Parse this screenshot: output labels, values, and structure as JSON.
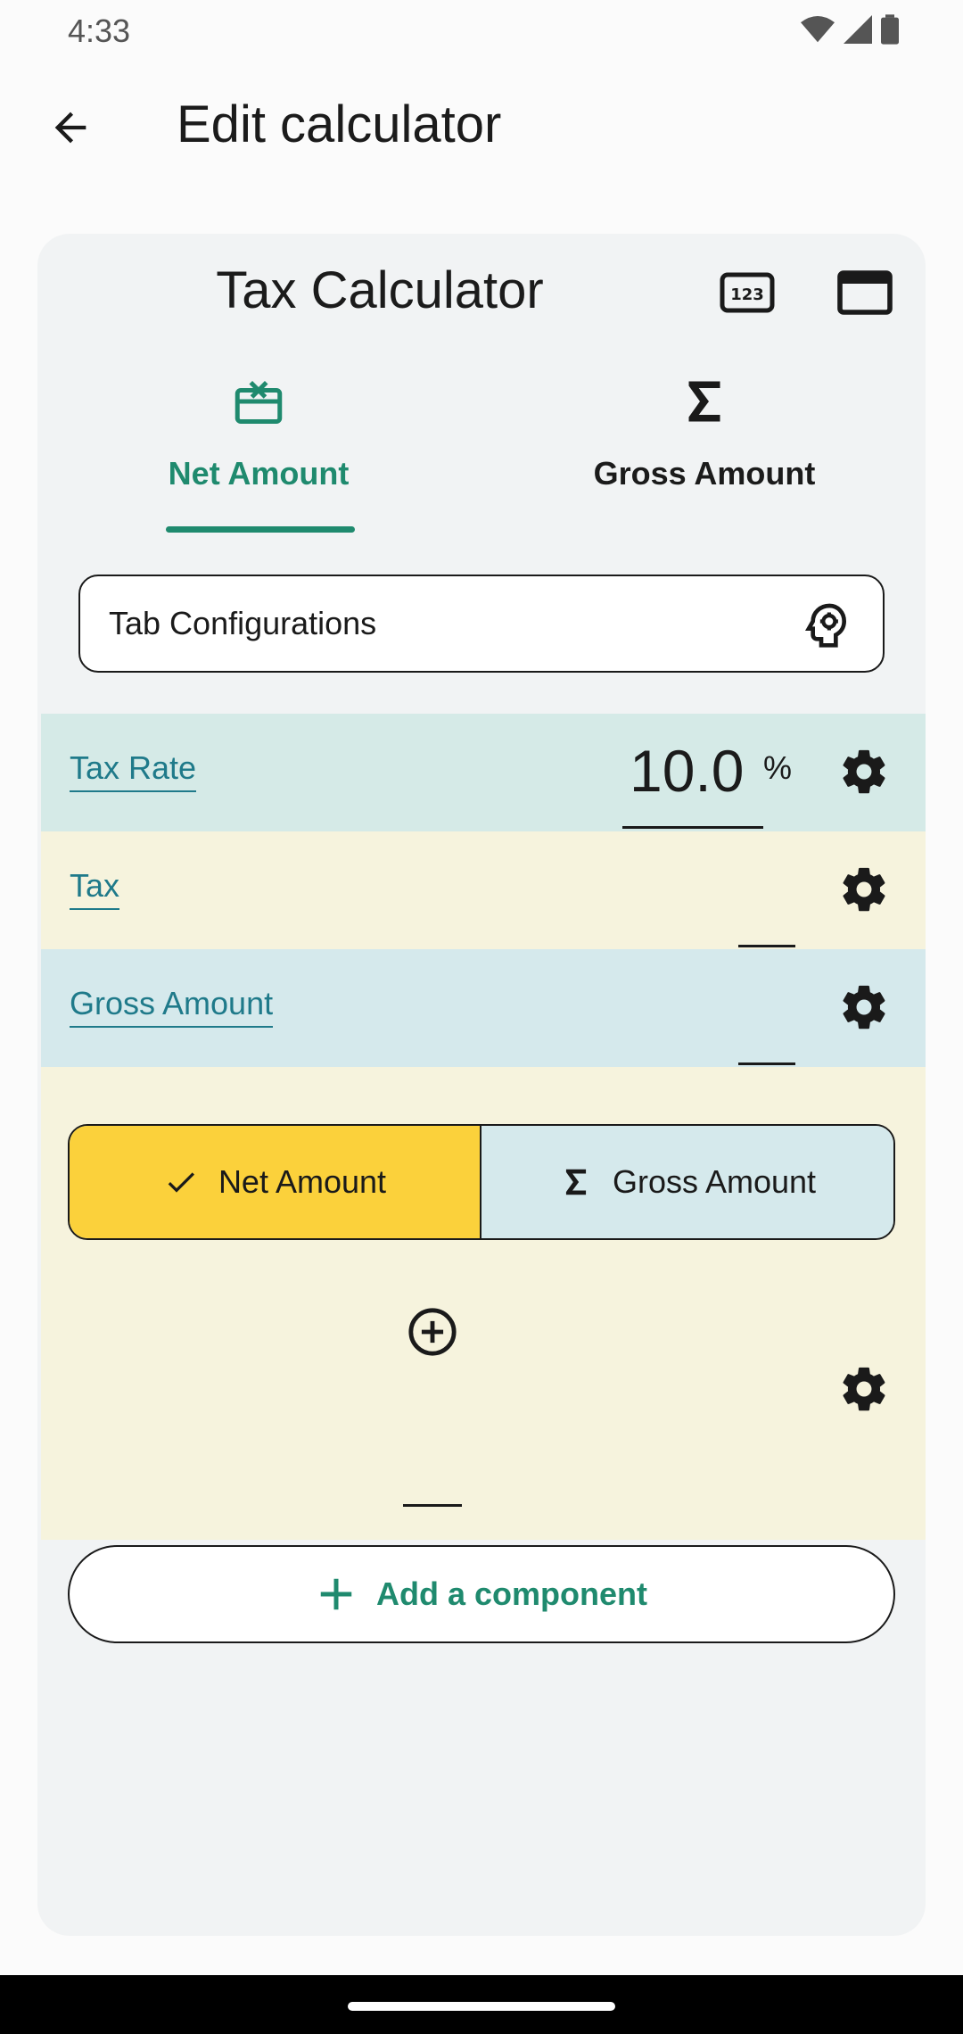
{
  "status_bar": {
    "time": "4:33"
  },
  "app_bar": {
    "title": "Edit calculator"
  },
  "calculator": {
    "title": "Tax Calculator",
    "tabs": [
      {
        "label": "Net Amount",
        "icon": "card-giftcard-icon",
        "selected": true
      },
      {
        "label": "Gross Amount",
        "icon": "sigma-icon",
        "selected": false
      }
    ],
    "tab_config": {
      "label": "Tab Configurations"
    },
    "rows": {
      "tax_rate": {
        "label": "Tax Rate",
        "value": "10.0",
        "unit": "%"
      },
      "tax": {
        "label": "Tax"
      },
      "gross_amount": {
        "label": "Gross Amount"
      }
    },
    "toggle": {
      "option_a": "Net Amount",
      "option_b": "Gross Amount",
      "selected": "Net Amount"
    },
    "add_component": {
      "label": "Add a component"
    }
  },
  "colors": {
    "accent": "#1f8a6e",
    "link": "#1f7a8a",
    "selected_toggle": "#fbd13b",
    "row_teal": "#d5eae7",
    "row_cream": "#f6f3dd"
  }
}
